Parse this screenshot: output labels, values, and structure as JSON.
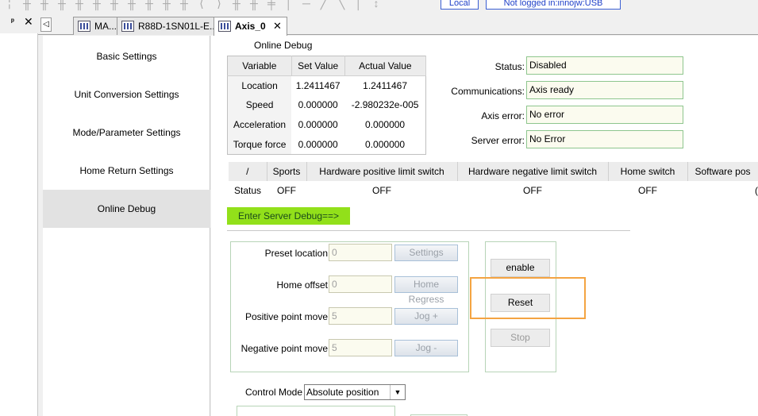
{
  "toolbar": {
    "glyphs": [
      "╎",
      "╫",
      "╫",
      "╫",
      "╫",
      "╫",
      "╫",
      "╫",
      "╫",
      "╫",
      "╫",
      "⟨",
      "⟩",
      "╫",
      "╫",
      "╪",
      "│",
      "─",
      "╱",
      "╲",
      "│",
      "↕"
    ],
    "mode_label": "Local",
    "login_status": "Not logged in:innojw:USB"
  },
  "dock": {
    "pin_glyph": "ᵖ",
    "close_glyph": "✕"
  },
  "tabs": {
    "nav_glyph": "◁",
    "items": [
      {
        "label": "MA..."
      },
      {
        "label": "R88D-1SN01L-E..."
      },
      {
        "label": "Axis_0"
      }
    ],
    "close_glyph": "✕"
  },
  "nav": {
    "items": [
      {
        "label": "Basic Settings"
      },
      {
        "label": "Unit Conversion Settings"
      },
      {
        "label": "Mode/Parameter Settings"
      },
      {
        "label": "Home Return Settings"
      },
      {
        "label": "Online Debug"
      }
    ],
    "selected": "Online Debug"
  },
  "online_debug": {
    "title": "Online Debug",
    "variables_table": {
      "headers": [
        "Variable",
        "Set Value",
        "Actual Value"
      ],
      "rows": [
        [
          "Location",
          "1.2411467",
          "1.2411467"
        ],
        [
          "Speed",
          "0.000000",
          "-2.980232e-005"
        ],
        [
          "Acceleration",
          "0.000000",
          "0.000000"
        ],
        [
          "Torque force",
          "0.000000",
          "0.000000"
        ]
      ]
    },
    "status_fields": [
      {
        "label": "Status:",
        "value": "Disabled"
      },
      {
        "label": "Communications:",
        "value": "Axis ready"
      },
      {
        "label": "Axis error:",
        "value": "No error"
      },
      {
        "label": "Server error:",
        "value": "No Error"
      }
    ],
    "limits_table": {
      "headers": [
        "/",
        "Sports",
        "Hardware positive limit switch",
        "Hardware negative limit switch",
        "Home switch",
        "Software pos"
      ],
      "row": [
        "Status",
        "OFF",
        "OFF",
        "OFF",
        "OFF",
        "("
      ]
    },
    "server_debug_button": "Enter Server Debug==>",
    "jog_fields": [
      {
        "label": "Preset location",
        "value": "0",
        "button": "Settings"
      },
      {
        "label": "Home offset",
        "value": "0",
        "button": "Home Regress"
      },
      {
        "label": "Positive point move",
        "value": "5",
        "button": "Jog +"
      },
      {
        "label": "Negative point move",
        "value": "5",
        "button": "Jog -"
      }
    ],
    "actions": {
      "enable": "enable",
      "reset": "Reset",
      "stop": "Stop"
    },
    "control_mode": {
      "label": "Control Mode",
      "value": "Absolute position",
      "arrow": "▼"
    }
  },
  "colors": {
    "green_button": "#92e01a",
    "highlight_orange": "#f4a442",
    "status_border": "#8ec68e",
    "link_blue": "#1e3fc8"
  }
}
